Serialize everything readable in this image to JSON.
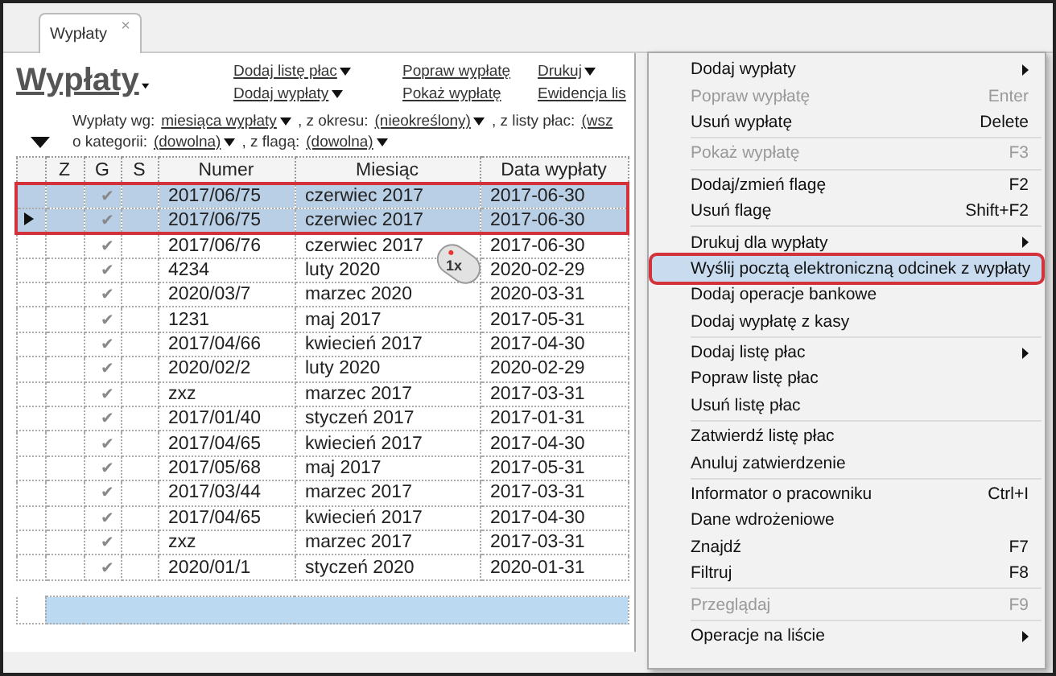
{
  "tab": {
    "label": "Wypłaty",
    "close": "×"
  },
  "title": "Wypłaty",
  "toolbar": [
    {
      "label": "Dodaj listę płac",
      "dropdown": true
    },
    {
      "label": "Dodaj wypłaty",
      "dropdown": true
    },
    {
      "label": "Popraw wypłatę",
      "dropdown": false
    },
    {
      "label": "Pokaż wypłatę",
      "dropdown": false
    },
    {
      "label": "Drukuj",
      "dropdown": true
    },
    {
      "label": "Ewidencja lis",
      "dropdown": false
    }
  ],
  "filters": [
    [
      {
        "kind": "text",
        "text": "Wypłaty wg:"
      },
      {
        "kind": "link",
        "text": "miesiąca wypłaty"
      },
      {
        "kind": "text",
        "text": ", z okresu:"
      },
      {
        "kind": "link",
        "text": "(nieokreślony)"
      },
      {
        "kind": "text",
        "text": ", z listy płac:"
      },
      {
        "kind": "cut",
        "text": "(wsz"
      }
    ],
    [
      {
        "kind": "text",
        "text": "o kategorii:"
      },
      {
        "kind": "link",
        "text": "(dowolna)"
      },
      {
        "kind": "text",
        "text": ", z flagą:"
      },
      {
        "kind": "link",
        "text": "(dowolna)"
      }
    ]
  ],
  "table": {
    "columns": [
      "Z",
      "G",
      "S",
      "Numer",
      "Miesiąc",
      "Data wypłaty"
    ],
    "rows": [
      {
        "g": "✔",
        "numer": "2017/06/75",
        "miesiac": "czerwiec 2017",
        "data": "2017-06-30",
        "selected": true,
        "current": false
      },
      {
        "g": "✔",
        "numer": "2017/06/75",
        "miesiac": "czerwiec 2017",
        "data": "2017-06-30",
        "selected": true,
        "current": true
      },
      {
        "g": "✔",
        "numer": "2017/06/76",
        "miesiac": "czerwiec 2017",
        "data": "2017-06-30",
        "selected": false,
        "current": false
      },
      {
        "g": "✔",
        "numer": "4234",
        "miesiac": "luty 2020",
        "data": "2020-02-29",
        "selected": false,
        "current": false
      },
      {
        "g": "✔",
        "numer": "2020/03/7",
        "miesiac": "marzec 2020",
        "data": "2020-03-31",
        "selected": false,
        "current": false
      },
      {
        "g": "✔",
        "numer": "1231",
        "miesiac": "maj 2017",
        "data": "2017-05-31",
        "selected": false,
        "current": false
      },
      {
        "g": "✔",
        "numer": "2017/04/66",
        "miesiac": "kwiecień 2017",
        "data": "2017-04-30",
        "selected": false,
        "current": false
      },
      {
        "g": "✔",
        "numer": "2020/02/2",
        "miesiac": "luty 2020",
        "data": "2020-02-29",
        "selected": false,
        "current": false
      },
      {
        "g": "✔",
        "numer": "zxz",
        "miesiac": "marzec 2017",
        "data": "2017-03-31",
        "selected": false,
        "current": false
      },
      {
        "g": "✔",
        "numer": "2017/01/40",
        "miesiac": "styczeń 2017",
        "data": "2017-01-31",
        "selected": false,
        "current": false
      },
      {
        "g": "✔",
        "numer": "2017/04/65",
        "miesiac": "kwiecień 2017",
        "data": "2017-04-30",
        "selected": false,
        "current": false
      },
      {
        "g": "✔",
        "numer": "2017/05/68",
        "miesiac": "maj 2017",
        "data": "2017-05-31",
        "selected": false,
        "current": false
      },
      {
        "g": "✔",
        "numer": "2017/03/44",
        "miesiac": "marzec 2017",
        "data": "2017-03-31",
        "selected": false,
        "current": false
      },
      {
        "g": "✔",
        "numer": "2017/04/65",
        "miesiac": "kwiecień 2017",
        "data": "2017-04-30",
        "selected": false,
        "current": false
      },
      {
        "g": "✔",
        "numer": "zxz",
        "miesiac": "marzec 2017",
        "data": "2017-03-31",
        "selected": false,
        "current": false
      },
      {
        "g": "✔",
        "numer": "2020/01/1",
        "miesiac": "styczeń 2020",
        "data": "2020-01-31",
        "selected": false,
        "current": false
      }
    ]
  },
  "cursor_badge": "1x",
  "menu": [
    {
      "kind": "item",
      "label": "Dodaj wypłaty",
      "submenu": true,
      "disabled": false,
      "selected": false
    },
    {
      "kind": "item",
      "label": "Popraw wypłatę",
      "shortcut": "Enter",
      "disabled": true,
      "selected": false
    },
    {
      "kind": "item",
      "label": "Usuń wypłatę",
      "shortcut": "Delete",
      "disabled": false,
      "selected": false
    },
    {
      "kind": "separator"
    },
    {
      "kind": "item",
      "label": "Pokaż wypłatę",
      "shortcut": "F3",
      "disabled": true,
      "selected": false
    },
    {
      "kind": "separator"
    },
    {
      "kind": "item",
      "label": "Dodaj/zmień flagę",
      "shortcut": "F2",
      "disabled": false,
      "selected": false
    },
    {
      "kind": "item",
      "label": "Usuń flagę",
      "shortcut": "Shift+F2",
      "disabled": false,
      "selected": false
    },
    {
      "kind": "separator"
    },
    {
      "kind": "item",
      "label": "Drukuj dla wypłaty",
      "submenu": true,
      "disabled": false,
      "selected": false
    },
    {
      "kind": "item",
      "label": "Wyślij pocztą elektroniczną odcinek z wypłaty",
      "disabled": false,
      "selected": true
    },
    {
      "kind": "item",
      "label": "Dodaj operacje bankowe",
      "disabled": false,
      "selected": false
    },
    {
      "kind": "item",
      "label": "Dodaj wypłatę z kasy",
      "disabled": false,
      "selected": false
    },
    {
      "kind": "separator"
    },
    {
      "kind": "item",
      "label": "Dodaj listę płac",
      "submenu": true,
      "disabled": false,
      "selected": false
    },
    {
      "kind": "item",
      "label": "Popraw listę płac",
      "disabled": false,
      "selected": false
    },
    {
      "kind": "item",
      "label": "Usuń listę płac",
      "disabled": false,
      "selected": false
    },
    {
      "kind": "separator"
    },
    {
      "kind": "item",
      "label": "Zatwierdź listę płac",
      "disabled": false,
      "selected": false
    },
    {
      "kind": "item",
      "label": "Anuluj zatwierdzenie",
      "disabled": false,
      "selected": false
    },
    {
      "kind": "separator"
    },
    {
      "kind": "item",
      "label": "Informator o pracowniku",
      "shortcut": "Ctrl+I",
      "disabled": false,
      "selected": false
    },
    {
      "kind": "item",
      "label": "Dane wdrożeniowe",
      "disabled": false,
      "selected": false
    },
    {
      "kind": "item",
      "label": "Znajdź",
      "shortcut": "F7",
      "disabled": false,
      "selected": false
    },
    {
      "kind": "item",
      "label": "Filtruj",
      "shortcut": "F8",
      "disabled": false,
      "selected": false
    },
    {
      "kind": "separator"
    },
    {
      "kind": "item",
      "label": "Przeglądaj",
      "shortcut": "F9",
      "disabled": true,
      "selected": false
    },
    {
      "kind": "separator"
    },
    {
      "kind": "item",
      "label": "Operacje na liście",
      "submenu": true,
      "disabled": false,
      "selected": false
    }
  ]
}
